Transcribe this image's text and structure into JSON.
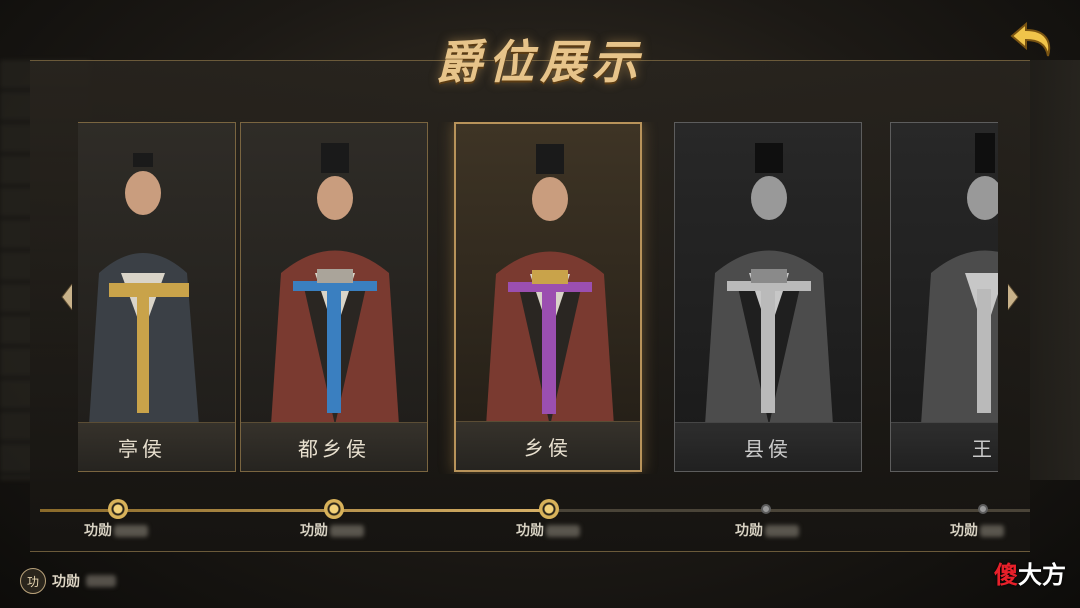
{
  "title": "爵位展示",
  "cards": [
    {
      "label": "亭侯",
      "sash_color": "#c9a34a",
      "state": "unlocked"
    },
    {
      "label": "都乡侯",
      "sash_color": "#3a7fc0",
      "state": "unlocked"
    },
    {
      "label": "乡侯",
      "sash_color": "#9b4fb0",
      "state": "selected"
    },
    {
      "label": "县侯",
      "sash_color": "#cfcfcf",
      "state": "locked"
    },
    {
      "label": "王",
      "sash_color": "#cfcfcf",
      "state": "locked"
    }
  ],
  "timeline": {
    "nodes": [
      {
        "label": "功勋",
        "reached": true
      },
      {
        "label": "功勋",
        "reached": true
      },
      {
        "label": "功勋",
        "reached": true
      },
      {
        "label": "功勋",
        "reached": false
      },
      {
        "label": "功勋",
        "reached": false
      }
    ]
  },
  "merit": {
    "badge": "功",
    "label": "功勋"
  },
  "watermark": {
    "part1": "傻",
    "part2": "大方"
  },
  "icons": {
    "back": "back-arrow-icon",
    "prev": "chevron-left-icon",
    "next": "chevron-right-icon"
  }
}
